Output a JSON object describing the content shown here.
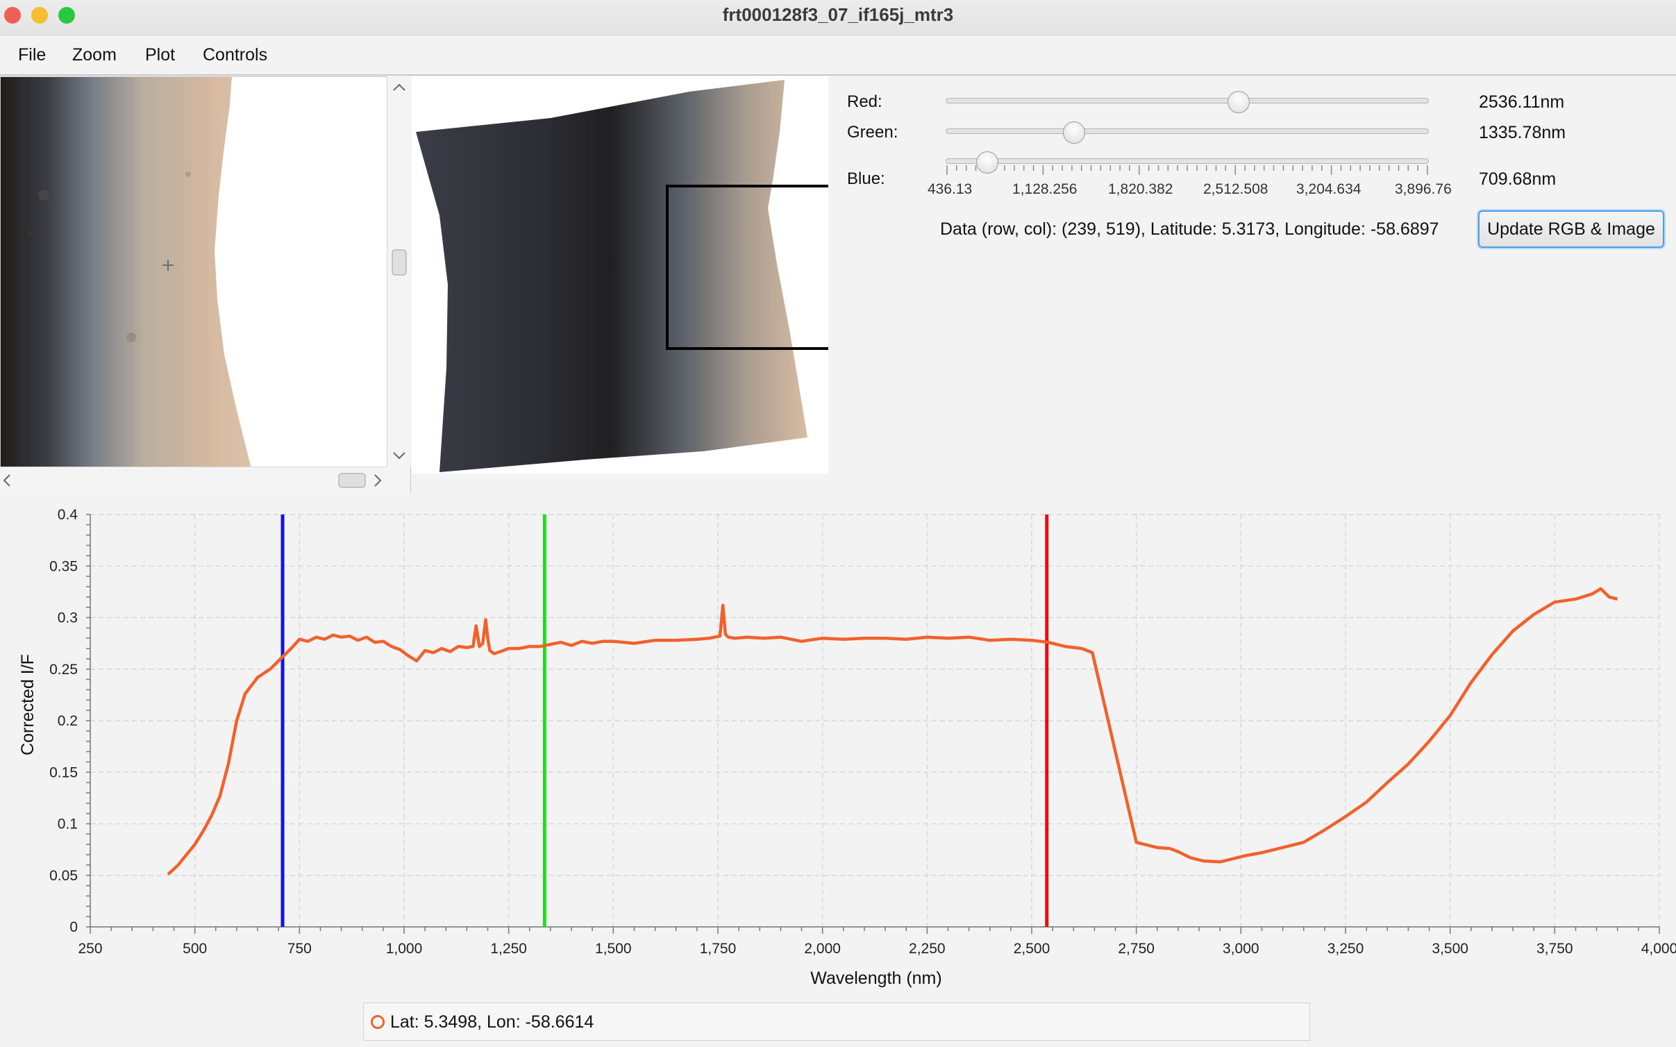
{
  "window": {
    "title": "frt000128f3_07_if165j_mtr3"
  },
  "menu": [
    "File",
    "Zoom",
    "Plot",
    "Controls"
  ],
  "controls": {
    "red": {
      "label": "Red:",
      "value": "2536.11nm",
      "wavelength_nm": 2536.11
    },
    "green": {
      "label": "Green:",
      "value": "1335.78nm",
      "wavelength_nm": 1335.78
    },
    "blue": {
      "label": "Blue:",
      "value": "709.68nm",
      "wavelength_nm": 709.68
    },
    "slider_min": 436.13,
    "slider_max": 3896.76,
    "tick_labels": [
      "436.13",
      "1,128.256",
      "1,820.382",
      "2,512.508",
      "3,204.634",
      "3,896.76"
    ],
    "data_info": "Data (row, col): (239, 519), Latitude: 5.3173, Longitude: -58.6897",
    "update_button": "Update RGB & Image"
  },
  "legend": {
    "text": "Lat: 5.3498, Lon: -58.6614",
    "color": "#f0612c"
  },
  "chart_data": {
    "type": "line",
    "xlabel": "Wavelength (nm)",
    "ylabel": "Corrected I/F",
    "xlim": [
      250,
      4000
    ],
    "ylim": [
      0,
      0.4
    ],
    "x_ticks": [
      250,
      500,
      750,
      1000,
      1250,
      1500,
      1750,
      2000,
      2250,
      2500,
      2750,
      3000,
      3250,
      3500,
      3750,
      4000
    ],
    "x_tick_labels": [
      "250",
      "500",
      "750",
      "1,000",
      "1,250",
      "1,500",
      "1,750",
      "2,000",
      "2,250",
      "2,500",
      "2,750",
      "3,000",
      "3,250",
      "3,500",
      "3,750",
      "4,000"
    ],
    "y_ticks": [
      0,
      0.05,
      0.1,
      0.15,
      0.2,
      0.25,
      0.3,
      0.35,
      0.4
    ],
    "y_tick_labels": [
      "0",
      "0.05",
      "0.1",
      "0.15",
      "0.2",
      "0.25",
      "0.3",
      "0.35",
      "0.4"
    ],
    "grid": true,
    "marker_lines": [
      {
        "x": 709.68,
        "color": "#1414e0"
      },
      {
        "x": 1335.78,
        "color": "#22dd22"
      },
      {
        "x": 2536.11,
        "color": "#e01010"
      }
    ],
    "series": [
      {
        "name": "Lat: 5.3498, Lon: -58.6614",
        "color": "#f0612c",
        "x": [
          436,
          460,
          480,
          500,
          520,
          540,
          560,
          580,
          600,
          620,
          650,
          680,
          710,
          730,
          750,
          770,
          790,
          810,
          830,
          850,
          870,
          890,
          910,
          930,
          950,
          970,
          990,
          1010,
          1030,
          1050,
          1070,
          1090,
          1110,
          1130,
          1150,
          1165,
          1172,
          1180,
          1188,
          1195,
          1200,
          1205,
          1215,
          1230,
          1250,
          1275,
          1300,
          1325,
          1350,
          1375,
          1400,
          1425,
          1450,
          1475,
          1500,
          1550,
          1600,
          1650,
          1700,
          1730,
          1755,
          1762,
          1768,
          1775,
          1790,
          1820,
          1860,
          1900,
          1950,
          2000,
          2050,
          2100,
          2150,
          2200,
          2250,
          2300,
          2350,
          2400,
          2450,
          2500,
          2540,
          2580,
          2620,
          2645,
          2700,
          2750,
          2800,
          2830,
          2850,
          2880,
          2910,
          2950,
          2980,
          3010,
          3050,
          3100,
          3150,
          3200,
          3250,
          3300,
          3350,
          3400,
          3450,
          3500,
          3550,
          3600,
          3650,
          3700,
          3750,
          3800,
          3840,
          3860,
          3880,
          3900
        ],
        "y": [
          0.051,
          0.06,
          0.07,
          0.08,
          0.093,
          0.108,
          0.127,
          0.158,
          0.2,
          0.226,
          0.242,
          0.25,
          0.262,
          0.27,
          0.279,
          0.277,
          0.281,
          0.279,
          0.283,
          0.281,
          0.282,
          0.278,
          0.281,
          0.276,
          0.277,
          0.272,
          0.269,
          0.263,
          0.258,
          0.268,
          0.266,
          0.27,
          0.267,
          0.272,
          0.271,
          0.272,
          0.292,
          0.272,
          0.275,
          0.298,
          0.28,
          0.268,
          0.265,
          0.267,
          0.27,
          0.27,
          0.272,
          0.272,
          0.274,
          0.276,
          0.273,
          0.277,
          0.275,
          0.277,
          0.277,
          0.275,
          0.278,
          0.278,
          0.279,
          0.28,
          0.282,
          0.312,
          0.284,
          0.281,
          0.28,
          0.281,
          0.28,
          0.281,
          0.277,
          0.28,
          0.279,
          0.28,
          0.28,
          0.279,
          0.281,
          0.28,
          0.281,
          0.278,
          0.279,
          0.278,
          0.276,
          0.272,
          0.27,
          0.266,
          0.17,
          0.082,
          0.077,
          0.076,
          0.073,
          0.067,
          0.064,
          0.063,
          0.066,
          0.069,
          0.072,
          0.077,
          0.082,
          0.094,
          0.107,
          0.121,
          0.14,
          0.158,
          0.18,
          0.205,
          0.237,
          0.264,
          0.287,
          0.303,
          0.315,
          0.318,
          0.323,
          0.328,
          0.32,
          0.318
        ]
      }
    ]
  }
}
